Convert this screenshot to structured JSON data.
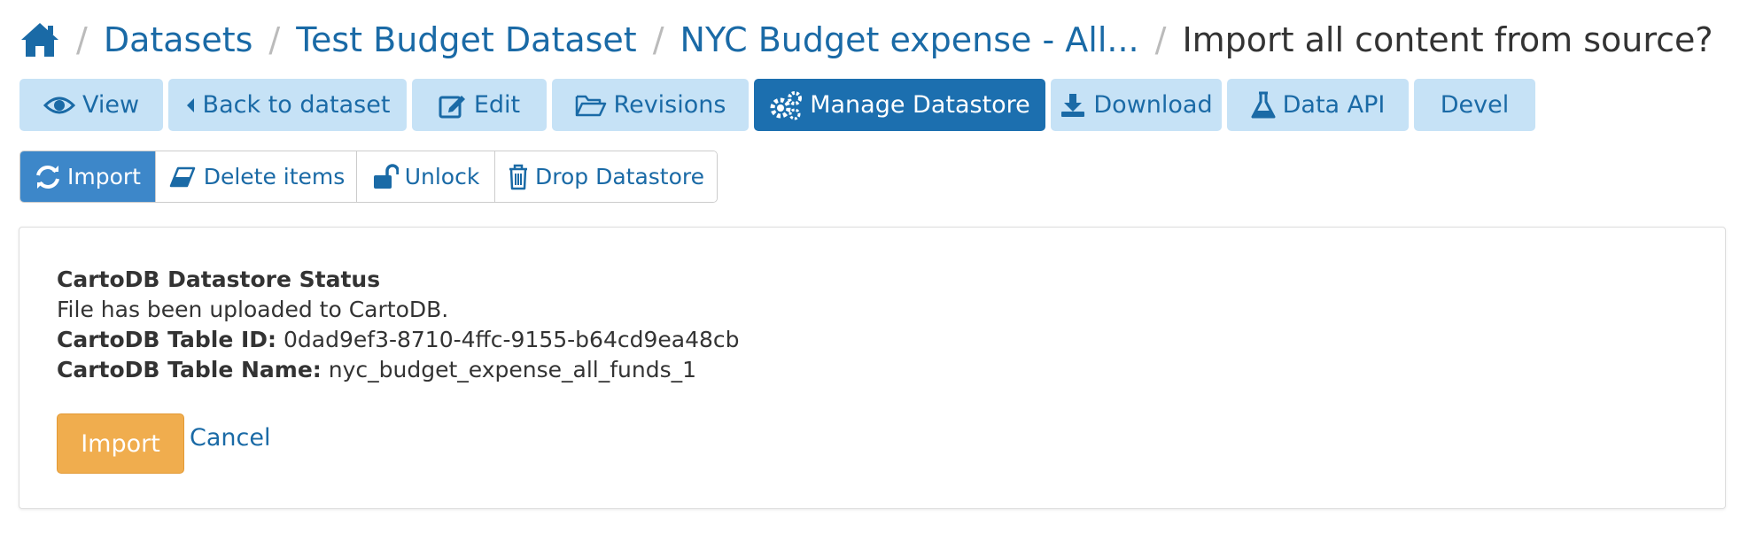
{
  "breadcrumb": {
    "items": [
      "Datasets",
      "Test Budget Dataset",
      "NYC Budget expense - All..."
    ],
    "current": "Import all content from source?",
    "separator": "/"
  },
  "nav": {
    "tabs": [
      {
        "label": "View",
        "icon": "eye-icon"
      },
      {
        "label": "Back to dataset",
        "icon": "caret-left-icon"
      },
      {
        "label": "Edit",
        "icon": "edit-icon"
      },
      {
        "label": "Revisions",
        "icon": "folder-open-icon"
      },
      {
        "label": "Manage Datastore",
        "icon": "cogs-icon",
        "active": true
      },
      {
        "label": "Download",
        "icon": "download-icon"
      },
      {
        "label": "Data API",
        "icon": "flask-icon"
      },
      {
        "label": "Devel",
        "icon": ""
      }
    ]
  },
  "subnav": {
    "buttons": [
      {
        "label": "Import",
        "icon": "refresh-icon",
        "active": true
      },
      {
        "label": "Delete items",
        "icon": "eraser-icon"
      },
      {
        "label": "Unlock",
        "icon": "unlock-icon"
      },
      {
        "label": "Drop Datastore",
        "icon": "trash-icon"
      }
    ]
  },
  "status": {
    "heading": "CartoDB Datastore Status",
    "message": "File has been uploaded to CartoDB.",
    "table_id_label": "CartoDB Table ID:",
    "table_id": "0dad9ef3-8710-4ffc-9155-b64cd9ea48cb",
    "table_name_label": "CartoDB Table Name:",
    "table_name": "nyc_budget_expense_all_funds_1"
  },
  "actions": {
    "import_label": "Import",
    "cancel_label": "Cancel"
  },
  "colors": {
    "link": "#1a6aa6",
    "nav_bg": "#c6e2f6",
    "nav_active": "#1c6faf",
    "sub_active": "#3d87c9",
    "import_button": "#f0ad4e"
  }
}
